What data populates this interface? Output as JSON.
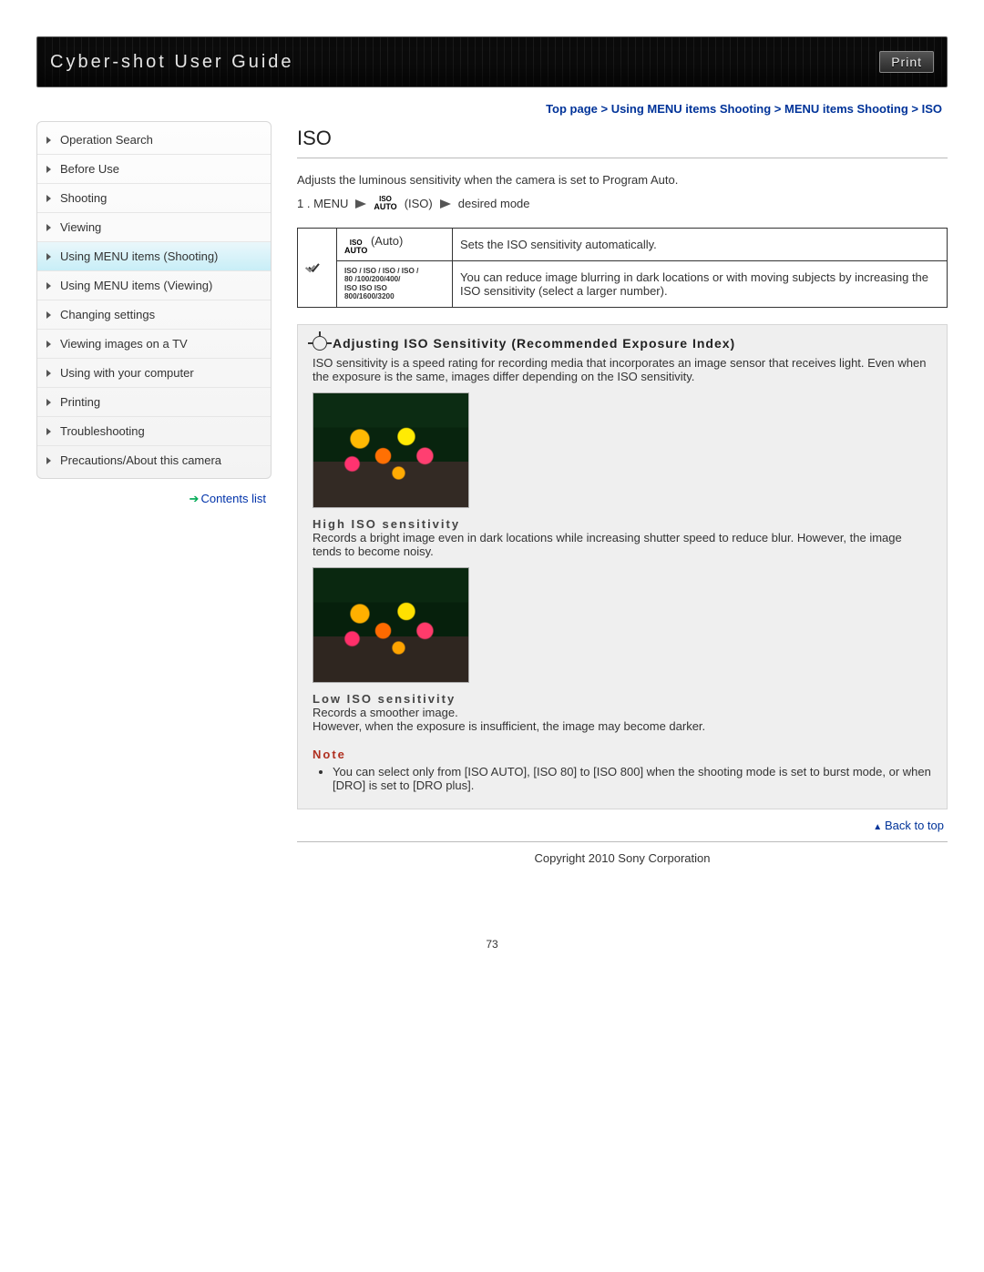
{
  "header": {
    "title": "Cyber-shot User Guide",
    "print_label": "Print"
  },
  "breadcrumb": "Top page > Using MENU items Shooting > MENU items Shooting > ISO",
  "sidebar": {
    "items": [
      {
        "label": "Operation Search",
        "active": false
      },
      {
        "label": "Before Use",
        "active": false
      },
      {
        "label": "Shooting",
        "active": false
      },
      {
        "label": "Viewing",
        "active": false
      },
      {
        "label": "Using MENU items (Shooting)",
        "active": true
      },
      {
        "label": "Using MENU items (Viewing)",
        "active": false
      },
      {
        "label": "Changing settings",
        "active": false
      },
      {
        "label": "Viewing images on a TV",
        "active": false
      },
      {
        "label": "Using with your computer",
        "active": false
      },
      {
        "label": "Printing",
        "active": false
      },
      {
        "label": "Troubleshooting",
        "active": false
      },
      {
        "label": "Precautions/About this camera",
        "active": false
      }
    ],
    "contents_link": "Contents list"
  },
  "main": {
    "title": "ISO",
    "intro": "Adjusts the luminous sensitivity when the camera is set to Program Auto.",
    "step_prefix": "1 .  MENU",
    "step_mid": "(ISO)",
    "step_suffix": "desired mode",
    "iso_glyph_top": "ISO",
    "iso_glyph_bottom": "AUTO",
    "table": {
      "row1_label": " (Auto)",
      "row1_desc": "Sets the ISO sensitivity automatically.",
      "row2_glyph_line1": "ISO / ISO / ISO / ISO /",
      "row2_glyph_line2": "80 /100/200/400/",
      "row2_glyph_line3": "ISO   ISO    ISO",
      "row2_glyph_line4": "800/1600/3200",
      "row2_desc": "You can reduce image blurring in dark locations or with moving subjects by increasing the ISO sensitivity (select a larger number)."
    },
    "info": {
      "heading": "Adjusting ISO Sensitivity (Recommended Exposure Index)",
      "p1": "ISO sensitivity is a speed rating for recording media that incorporates an image sensor that receives light. Even when the exposure is the same, images differ depending on the ISO sensitivity.",
      "high_h": "High ISO sensitivity",
      "high_p": "Records a bright image even in dark locations while increasing shutter speed to reduce blur. However, the image tends to become noisy.",
      "low_h": "Low ISO sensitivity",
      "low_p1": "Records a smoother image.",
      "low_p2": "However, when the exposure is insufficient, the image may become darker.",
      "note_h": "Note",
      "note_item": "You can select only from [ISO AUTO], [ISO 80] to [ISO 800] when the shooting mode is set to burst mode, or when [DRO] is set to [DRO plus]."
    },
    "back_to_top": "Back to top",
    "copyright": "Copyright 2010 Sony Corporation",
    "page_number": "73"
  }
}
